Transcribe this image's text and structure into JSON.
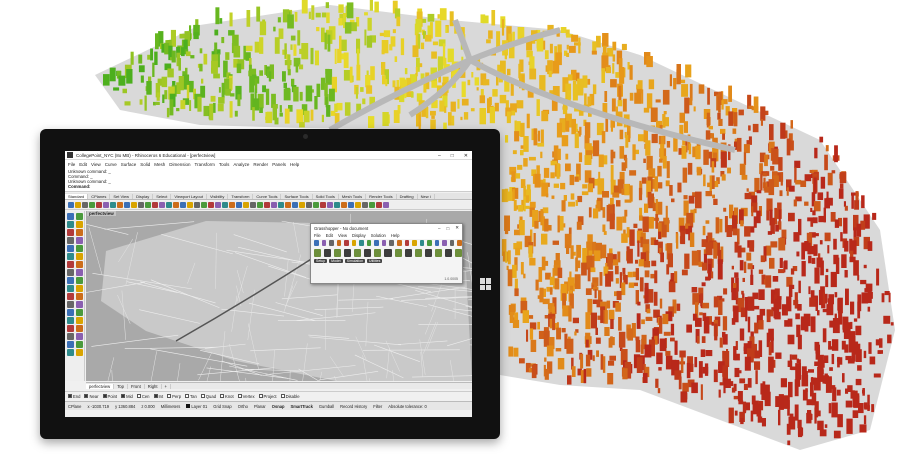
{
  "colors": {
    "road": "#b8b8b8",
    "green_low": "#4caf1e",
    "yellow_mid": "#e8dc2a",
    "orange": "#e89a1a",
    "red_high": "#b8281a",
    "viewport_bg": "#a9a9a9"
  },
  "window": {
    "title": "CollegePoint_NYC (8o MB) - Rhinoceros 6 Educational - [perfectview]",
    "minimize": "–",
    "maximize": "□",
    "close": "✕"
  },
  "menu": [
    "File",
    "Edit",
    "View",
    "Curve",
    "Surface",
    "Solid",
    "Mesh",
    "Dimension",
    "Transform",
    "Tools",
    "Analyze",
    "Render",
    "Panels",
    "Help"
  ],
  "command_history": [
    "Unknown command: _",
    "Command: _",
    "Unknown command: _"
  ],
  "command_prompt": "Command:",
  "toolbar_tabs": [
    "Standard",
    "CPlanes",
    "Set View",
    "Display",
    "Select",
    "Viewport Layout",
    "Visibility",
    "Transform",
    "Curve Tools",
    "Surface Tools",
    "Solid Tools",
    "Mesh Tools",
    "Render Tools",
    "Drafting",
    "New i"
  ],
  "viewport_label": "perfectview",
  "grasshopper": {
    "title": "Grasshopper - No document",
    "menu": [
      "File",
      "Edit",
      "View",
      "Display",
      "Solution",
      "Help"
    ],
    "categories": [
      "Setup",
      "Model",
      "Simulation",
      "Utilities"
    ],
    "version": "1.0.0005"
  },
  "view_tabs": [
    "perfectview",
    "Top",
    "Front",
    "Right",
    "+"
  ],
  "osnaps": [
    {
      "label": "End",
      "checked": true
    },
    {
      "label": "Near",
      "checked": true
    },
    {
      "label": "Point",
      "checked": true
    },
    {
      "label": "Mid",
      "checked": true
    },
    {
      "label": "Cen",
      "checked": false
    },
    {
      "label": "Int",
      "checked": true
    },
    {
      "label": "Perp",
      "checked": false
    },
    {
      "label": "Tan",
      "checked": false
    },
    {
      "label": "Quad",
      "checked": false
    },
    {
      "label": "Knot",
      "checked": false
    },
    {
      "label": "Vertex",
      "checked": false
    },
    {
      "label": "Project",
      "checked": false
    },
    {
      "label": "Disable",
      "checked": false
    }
  ],
  "status": {
    "cplane": "CPlane",
    "x": "x -1030.719",
    "y": "y 1360.884",
    "z": "z 0.000",
    "units": "Millimeters",
    "layer": "Layer 01",
    "grid_snap": "Grid Snap",
    "ortho": "Ortho",
    "planar": "Planar",
    "osnap": "Osnap",
    "smarttrack": "SmartTrack",
    "gumball": "Gumball",
    "record_history": "Record History",
    "filter": "Filter",
    "tolerance": "Absolute tolerance: 0"
  }
}
